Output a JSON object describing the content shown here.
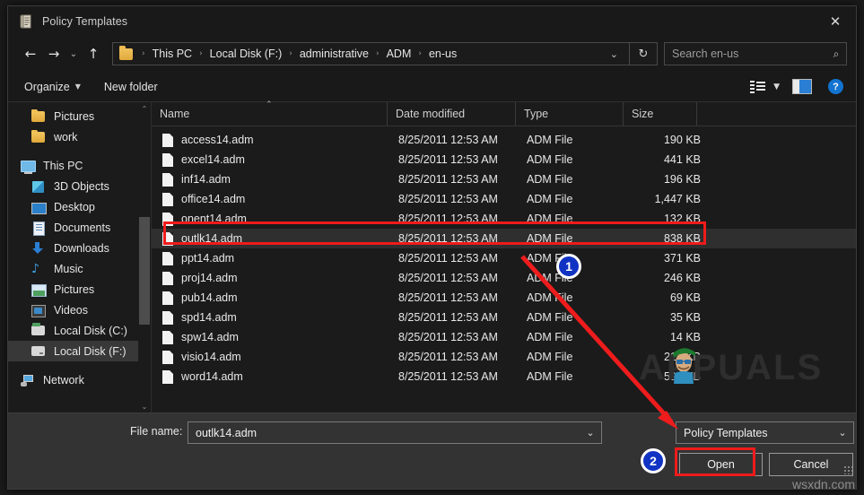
{
  "window": {
    "title": "Policy Templates",
    "title_icon": "policy-template-scroll-icon",
    "close_label": "✕"
  },
  "nav": {
    "back": "←",
    "forward": "→",
    "recent": "⌄",
    "up": "↑",
    "refresh": "↻",
    "dropdown": "⌄",
    "breadcrumbs": [
      "This PC",
      "Local Disk (F:)",
      "administrative",
      "ADM",
      "en-us"
    ],
    "separator": "›"
  },
  "search": {
    "placeholder": "Search en-us",
    "icon": "⌕"
  },
  "toolbar": {
    "organize_label": "Organize",
    "organize_caret": "▼",
    "new_folder_label": "New folder",
    "view_caret": "▼",
    "help_label": "?"
  },
  "sidebar": {
    "items": [
      {
        "label": "Pictures",
        "icon": "folder-icon",
        "indent": "indent",
        "selected": false,
        "gap_before": false
      },
      {
        "label": "work",
        "icon": "folder-icon",
        "indent": "indent",
        "selected": false,
        "gap_before": false
      },
      {
        "label": "This PC",
        "icon": "this-pc-icon",
        "indent": "root",
        "selected": false,
        "gap_before": true
      },
      {
        "label": "3D Objects",
        "icon": "3d-objects-icon",
        "indent": "indent",
        "selected": false,
        "gap_before": false
      },
      {
        "label": "Desktop",
        "icon": "desktop-icon",
        "indent": "indent",
        "selected": false,
        "gap_before": false
      },
      {
        "label": "Documents",
        "icon": "documents-icon",
        "indent": "indent",
        "selected": false,
        "gap_before": false
      },
      {
        "label": "Downloads",
        "icon": "downloads-icon",
        "indent": "indent",
        "selected": false,
        "gap_before": false
      },
      {
        "label": "Music",
        "icon": "music-icon",
        "indent": "indent",
        "selected": false,
        "gap_before": false
      },
      {
        "label": "Pictures",
        "icon": "pictures-icon",
        "indent": "indent",
        "selected": false,
        "gap_before": false
      },
      {
        "label": "Videos",
        "icon": "videos-icon",
        "indent": "indent",
        "selected": false,
        "gap_before": false
      },
      {
        "label": "Local Disk (C:)",
        "icon": "local-disk-c-icon",
        "indent": "indent",
        "selected": false,
        "gap_before": false
      },
      {
        "label": "Local Disk (F:)",
        "icon": "local-disk-f-icon",
        "indent": "indent",
        "selected": true,
        "gap_before": false
      },
      {
        "label": "Network",
        "icon": "network-icon",
        "indent": "root",
        "selected": false,
        "gap_before": true
      }
    ],
    "scroll_up": "⌃",
    "scroll_down": "⌄"
  },
  "filelist": {
    "columns": [
      "Name",
      "Date modified",
      "Type",
      "Size"
    ],
    "sort_arrow": "⌃",
    "rows": [
      {
        "name": "access14.adm",
        "date": "8/25/2011 12:53 AM",
        "type": "ADM File",
        "size": "190 KB",
        "selected": false
      },
      {
        "name": "excel14.adm",
        "date": "8/25/2011 12:53 AM",
        "type": "ADM File",
        "size": "441 KB",
        "selected": false
      },
      {
        "name": "inf14.adm",
        "date": "8/25/2011 12:53 AM",
        "type": "ADM File",
        "size": "196 KB",
        "selected": false
      },
      {
        "name": "office14.adm",
        "date": "8/25/2011 12:53 AM",
        "type": "ADM File",
        "size": "1,447 KB",
        "selected": false
      },
      {
        "name": "onent14.adm",
        "date": "8/25/2011 12:53 AM",
        "type": "ADM File",
        "size": "132 KB",
        "selected": false
      },
      {
        "name": "outlk14.adm",
        "date": "8/25/2011 12:53 AM",
        "type": "ADM File",
        "size": "838 KB",
        "selected": true
      },
      {
        "name": "ppt14.adm",
        "date": "8/25/2011 12:53 AM",
        "type": "ADM File",
        "size": "371 KB",
        "selected": false
      },
      {
        "name": "proj14.adm",
        "date": "8/25/2011 12:53 AM",
        "type": "ADM File",
        "size": "246 KB",
        "selected": false
      },
      {
        "name": "pub14.adm",
        "date": "8/25/2011 12:53 AM",
        "type": "ADM File",
        "size": "69 KB",
        "selected": false
      },
      {
        "name": "spd14.adm",
        "date": "8/25/2011 12:53 AM",
        "type": "ADM File",
        "size": "35 KB",
        "selected": false
      },
      {
        "name": "spw14.adm",
        "date": "8/25/2011 12:53 AM",
        "type": "ADM File",
        "size": "14 KB",
        "selected": false
      },
      {
        "name": "visio14.adm",
        "date": "8/25/2011 12:53 AM",
        "type": "ADM File",
        "size": "210 KB",
        "selected": false
      },
      {
        "name": "word14.adm",
        "date": "8/25/2011 12:53 AM",
        "type": "ADM File",
        "size": "596 KB",
        "selected": false
      }
    ]
  },
  "footer": {
    "filename_label": "File name:",
    "filename_value": "outlk14.adm",
    "filename_caret": "⌄",
    "filter_value": "Policy Templates",
    "filter_caret": "⌄",
    "open_label": "Open",
    "cancel_label": "Cancel"
  },
  "annotations": {
    "marker_1": "1",
    "marker_2": "2",
    "highlight_color": "#ef1b1b",
    "marker_color": "#1033c4"
  },
  "watermarks": {
    "brand": "APPUALS",
    "site": "wsxdn.com"
  }
}
